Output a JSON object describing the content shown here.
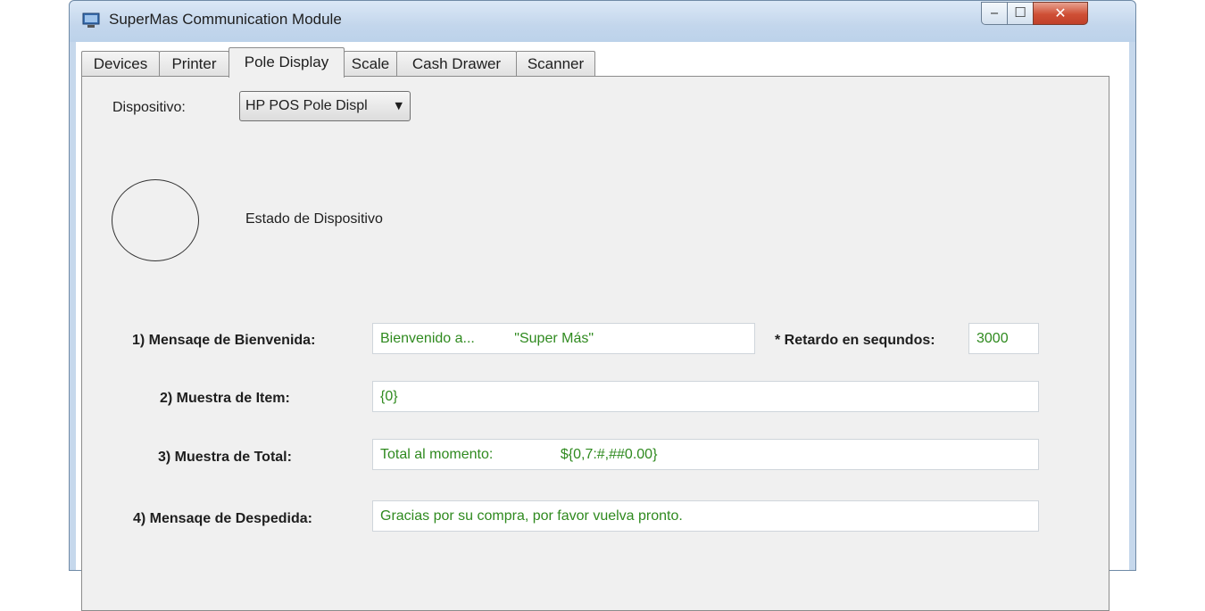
{
  "window": {
    "title": "SuperMas Communication Module",
    "controls": {
      "minimize": "‒",
      "maximize": "☐",
      "close": "✕"
    }
  },
  "tabs": [
    {
      "label": "Devices"
    },
    {
      "label": "Printer"
    },
    {
      "label": "Pole Display",
      "active": true
    },
    {
      "label": "Scale"
    },
    {
      "label": "Cash Drawer"
    },
    {
      "label": "Scanner"
    }
  ],
  "pole_display": {
    "device_label": "Dispositivo:",
    "device_selected": "HP POS Pole Displ",
    "status_label": "Estado de Dispositivo",
    "welcome_label": "1) Mensaqe de Bienvenida:",
    "welcome_value": "Bienvenido a...          \"Super Más\"",
    "delay_label": "* Retardo en sequndos:",
    "delay_value": "3000",
    "item_label": "2) Muestra de Item:",
    "item_value": "{0}",
    "total_label": "3) Muestra de Total:",
    "total_value": "Total al momento:                 ${0,7:#,##0.00}",
    "farewell_label": "4) Mensaqe de Despedida:",
    "farewell_value": "Gracias por su compra, por favor vuelva pronto."
  },
  "colors": {
    "input_text": "#2f8a1f",
    "panel_bg": "#f0f0f0",
    "frame": "#c6d8ec"
  },
  "icons": {
    "app": "monitor-icon",
    "dropdown": "chevron-down-icon"
  }
}
